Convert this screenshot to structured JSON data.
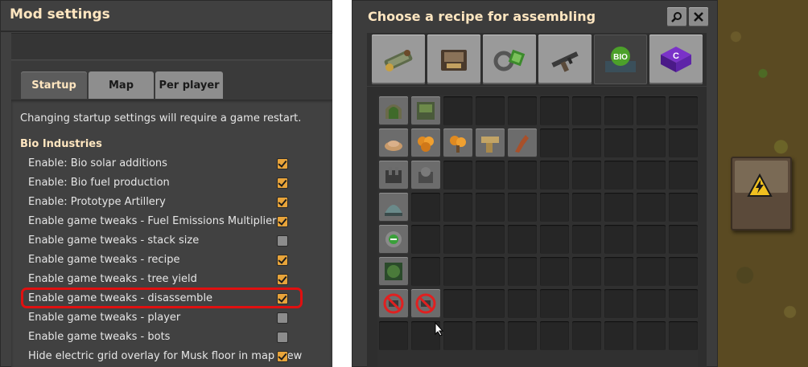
{
  "mod_settings": {
    "title": "Mod settings",
    "tabs": [
      {
        "label": "Startup",
        "active": true
      },
      {
        "label": "Map",
        "active": false
      },
      {
        "label": "Per player",
        "active": false
      }
    ],
    "restart_note": "Changing startup settings will require a game restart.",
    "section_title": "Bio Industries",
    "settings": [
      {
        "label": "Enable: Bio solar additions",
        "checked": true
      },
      {
        "label": "Enable: Bio fuel production",
        "checked": true
      },
      {
        "label": "Enable: Prototype Artillery",
        "checked": true
      },
      {
        "label": "Enable game tweaks - Fuel Emissions Multipliers",
        "checked": true
      },
      {
        "label": "Enable game tweaks - stack size",
        "checked": false
      },
      {
        "label": "Enable game tweaks - recipe",
        "checked": true
      },
      {
        "label": "Enable game tweaks - tree yield",
        "checked": true
      },
      {
        "label": "Enable game tweaks - disassemble",
        "checked": true,
        "highlighted": true
      },
      {
        "label": "Enable game tweaks - player",
        "checked": false
      },
      {
        "label": "Enable game tweaks - bots",
        "checked": false
      },
      {
        "label": "Hide electric grid overlay for Musk floor in map view",
        "checked": true
      }
    ],
    "colors": {
      "highlight": "#e01010",
      "checkbox_on": "#e8a43a",
      "title": "#ffe6c0"
    }
  },
  "recipe_chooser": {
    "title": "Choose a recipe for assembling",
    "search_icon": "search-icon",
    "close_icon": "close-icon",
    "group_tabs": [
      {
        "icon": "logistics-group-icon",
        "active": false
      },
      {
        "icon": "production-group-icon",
        "active": false
      },
      {
        "icon": "intermediate-products-group-icon",
        "active": false
      },
      {
        "icon": "combat-group-icon",
        "active": false
      },
      {
        "icon": "bio-industries-group-icon",
        "active": true,
        "badge": "BIO"
      },
      {
        "icon": "c-mod-group-icon",
        "active": false,
        "badge": "C"
      }
    ],
    "recipe_rows": [
      [
        "bio-greenhouse-icon",
        "bio-farm-icon"
      ],
      [
        "wood-pulp-icon",
        "seedling-icon",
        "seedling-variant-icon",
        "wood-bricks-icon",
        "wood-fragment-icon"
      ],
      [
        "bio-cannon-icon",
        "bio-turret-icon"
      ],
      [
        "bio-dome-icon"
      ],
      [
        "bio-lamp-icon"
      ],
      [
        "bio-garden-icon"
      ],
      [
        "disassemble-blocked-icon",
        "disassemble-blocked-icon"
      ]
    ]
  },
  "world": {
    "machine_icon": "assembling-machine-icon",
    "warning_icon": "no-power-warning-icon"
  }
}
